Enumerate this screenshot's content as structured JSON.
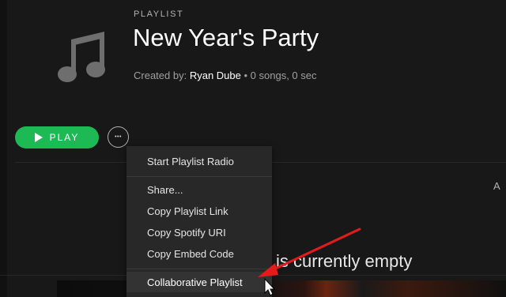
{
  "playlist": {
    "type_label": "PLAYLIST",
    "title": "New Year's Party",
    "created_by_label": "Created by:",
    "owner": "Ryan Dube",
    "stats": "• 0 songs, 0 sec"
  },
  "controls": {
    "play_label": "PLAY",
    "more_glyph": "•••"
  },
  "context_menu": {
    "items": [
      {
        "label": "Start Playlist Radio"
      },
      {
        "label": "Share..."
      },
      {
        "label": "Copy Playlist Link"
      },
      {
        "label": "Copy Spotify URI"
      },
      {
        "label": "Copy Embed Code"
      },
      {
        "label": "Collaborative Playlist"
      }
    ],
    "hovered": "Collaborative Playlist"
  },
  "main": {
    "empty_message": "list is currently empty",
    "cut_header_letter": "A"
  },
  "icons": {
    "cover": "music-note-icon",
    "play": "play-icon",
    "more": "more-dots-icon",
    "cursor": "mouse-pointer-icon",
    "annotation": "red-arrow-annotation"
  },
  "colors": {
    "background": "#181818",
    "accent_green": "#1db954",
    "menu_bg": "#282828",
    "annotation_red": "#e31b1b"
  }
}
